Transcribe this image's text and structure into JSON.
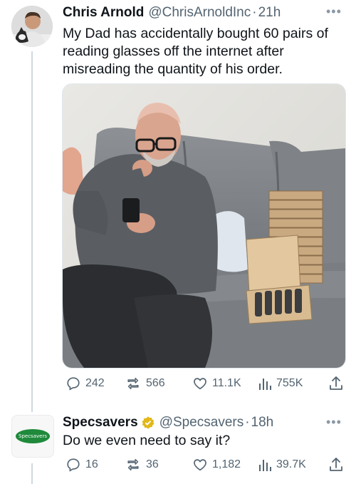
{
  "tweet1": {
    "display_name": "Chris Arnold",
    "handle": "@ChrisArnoldInc",
    "time": "21h",
    "text_lines": [
      "My Dad has accidentally bought 60 pairs of",
      "reading glasses off the internet after",
      "misreading the quantity of his order."
    ],
    "stats": {
      "replies": "242",
      "retweets": "566",
      "likes": "11.1K",
      "views": "755K"
    }
  },
  "tweet2": {
    "display_name": "Specsavers",
    "handle": "@Specsavers",
    "time": "18h",
    "text": "Do we even need to say it?",
    "avatar_text": "Specsavers",
    "stats": {
      "replies": "16",
      "retweets": "36",
      "likes": "1,182",
      "views": "39.7K"
    }
  },
  "icons": {
    "reply": "reply-icon",
    "retweet": "retweet-icon",
    "like": "heart-icon",
    "views": "views-icon",
    "share": "share-icon",
    "verified": "verified-badge-icon",
    "more": "more-icon"
  },
  "colors": {
    "text": "#0f1419",
    "secondary": "#536471",
    "specsavers_green": "#1f8a3b",
    "verified_gold": "#e2b719"
  }
}
